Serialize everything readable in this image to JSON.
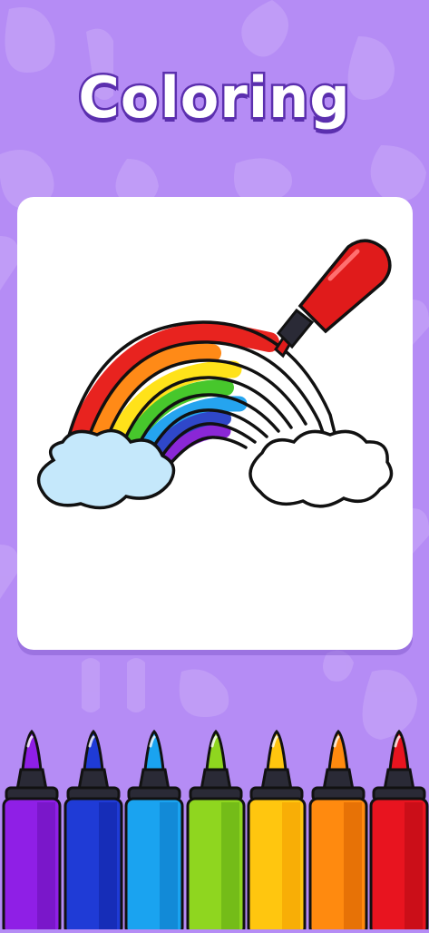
{
  "title": "Coloring",
  "colors": {
    "background": "#b58cf5",
    "title_outline": "#5b2fae",
    "card": "#ffffff",
    "outline": "#111111"
  },
  "drawing": {
    "subject": "rainbow",
    "stripes": [
      "#e8231f",
      "#ff8a17",
      "#ffe21a",
      "#47c72c",
      "#25a4ef",
      "#2f47c9",
      "#8a27d6"
    ],
    "left_cloud_fill": "#c5e8fb",
    "right_cloud_fill": "#ffffff",
    "pen_color": "#e01b1b"
  },
  "palette": [
    {
      "name": "purple",
      "color": "#8f1fe6",
      "dark": "#6a10b3"
    },
    {
      "name": "navy",
      "color": "#1f3bd6",
      "dark": "#0f22a1"
    },
    {
      "name": "sky-blue",
      "color": "#1aa3f0",
      "dark": "#0d76c2"
    },
    {
      "name": "green",
      "color": "#8fd61f",
      "dark": "#5fa812"
    },
    {
      "name": "yellow",
      "color": "#ffc60f",
      "dark": "#f39a00"
    },
    {
      "name": "orange",
      "color": "#ff8a0f",
      "dark": "#d45f00"
    },
    {
      "name": "red",
      "color": "#e8141f",
      "dark": "#b30a12"
    }
  ]
}
